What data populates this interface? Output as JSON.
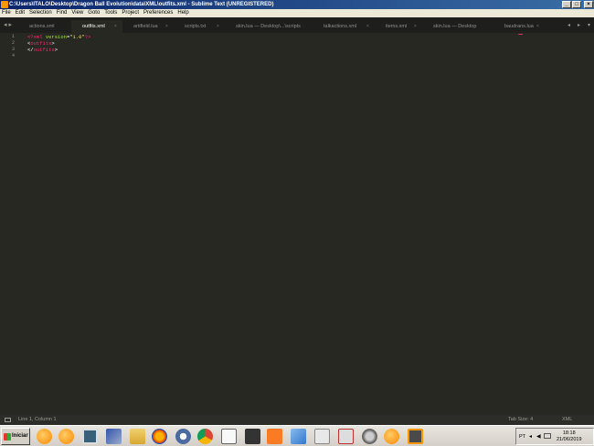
{
  "window": {
    "title": "C:\\Users\\ITALO\\Desktop\\Dragon Ball Evolution\\data\\XML\\outfits.xml - Sublime Text (UNREGISTERED)"
  },
  "menu": [
    "File",
    "Edit",
    "Selection",
    "Find",
    "View",
    "Goto",
    "Tools",
    "Project",
    "Preferences",
    "Help"
  ],
  "tabs": [
    {
      "label": "actions.xml",
      "active": false
    },
    {
      "label": "outfits.xml",
      "active": true
    },
    {
      "label": "artifield.lua",
      "active": false
    },
    {
      "label": "scripts.txt",
      "active": false
    },
    {
      "label": "skin.lua — Desktop\\...\\scripts",
      "active": false
    },
    {
      "label": "talkactions.xml",
      "active": false
    },
    {
      "label": "items.xml",
      "active": false
    },
    {
      "label": "skin.lua — Desktop",
      "active": false
    },
    {
      "label": "baudrans.lua",
      "active": false
    }
  ],
  "editor": {
    "line_numbers": [
      "1",
      "2",
      "3",
      "4"
    ]
  },
  "status": {
    "position": "Line 1, Column 1",
    "tab_size": "Tab Size: 4",
    "syntax": "XML"
  },
  "taskbar": {
    "start_label": "Iniciar",
    "language": "PT",
    "time": "18:18",
    "date": "21/06/2019"
  },
  "colors": {
    "editor_bg": "#272822",
    "tag": "#f92672",
    "attribute": "#a6e22e",
    "string": "#e6db74"
  }
}
